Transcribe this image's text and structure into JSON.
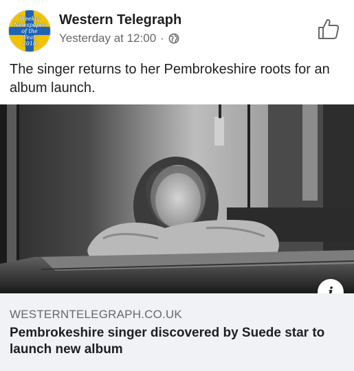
{
  "post": {
    "page_name": "Western Telegraph",
    "timestamp": "Yesterday at 12:00",
    "separator": "·",
    "privacy_icon": "globe-icon",
    "caption": "The singer returns to her Pembrokeshire roots for an album launch."
  },
  "avatar": {
    "lines": [
      "Weekly",
      "Newspaper",
      "of the",
      "Year",
      "2018"
    ],
    "colors": {
      "background": "#f2c200",
      "cross": "#1f64b3"
    }
  },
  "actions": {
    "like_icon": "thumbs-up-icon",
    "info_icon": "info-icon",
    "info_glyph": "i"
  },
  "link_preview": {
    "domain": "WESTERNTELEGRAPH.CO.UK",
    "headline": "Pembrokeshire singer discovered by Suede star to launch new album"
  },
  "colors": {
    "text": "#1c1e21",
    "secondary": "#65676b",
    "link_bg": "#f0f2f5"
  }
}
